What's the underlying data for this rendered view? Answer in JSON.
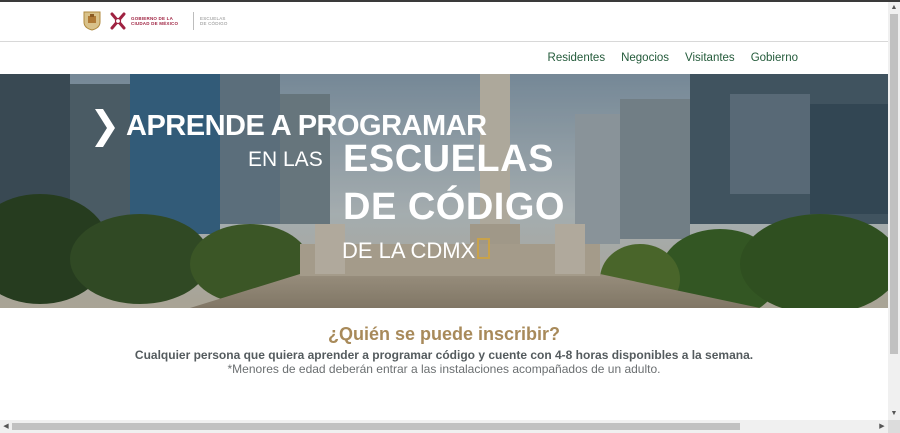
{
  "header": {
    "logo_line1": "GOBIERNO DE LA",
    "logo_line2": "CIUDAD DE MÉXICO",
    "logo_sub1": "ESCUELAS",
    "logo_sub2": "DE CÓDIGO"
  },
  "nav": {
    "items": [
      {
        "label": "Residentes"
      },
      {
        "label": "Negocios"
      },
      {
        "label": "Visitantes"
      },
      {
        "label": "Gobierno"
      }
    ]
  },
  "hero": {
    "line1": "APRENDE A PROGRAMAR",
    "line2a": "EN LAS",
    "line2b": "ESCUELAS",
    "line3": "DE CÓDIGO",
    "line4": "DE LA CDMX"
  },
  "section": {
    "title": "¿Quién se puede inscribir?",
    "description": "Cualquier persona que quiera aprender a programar código y cuente con 4-8 horas disponibles a la semana.",
    "note": "*Menores de edad deberán entrar a las instalaciones acompañados de un adulto."
  },
  "colors": {
    "nav_link": "#245b3b",
    "brand": "#9f2241",
    "section_title": "#a88a5a",
    "cursor_accent": "#c9a24a"
  }
}
